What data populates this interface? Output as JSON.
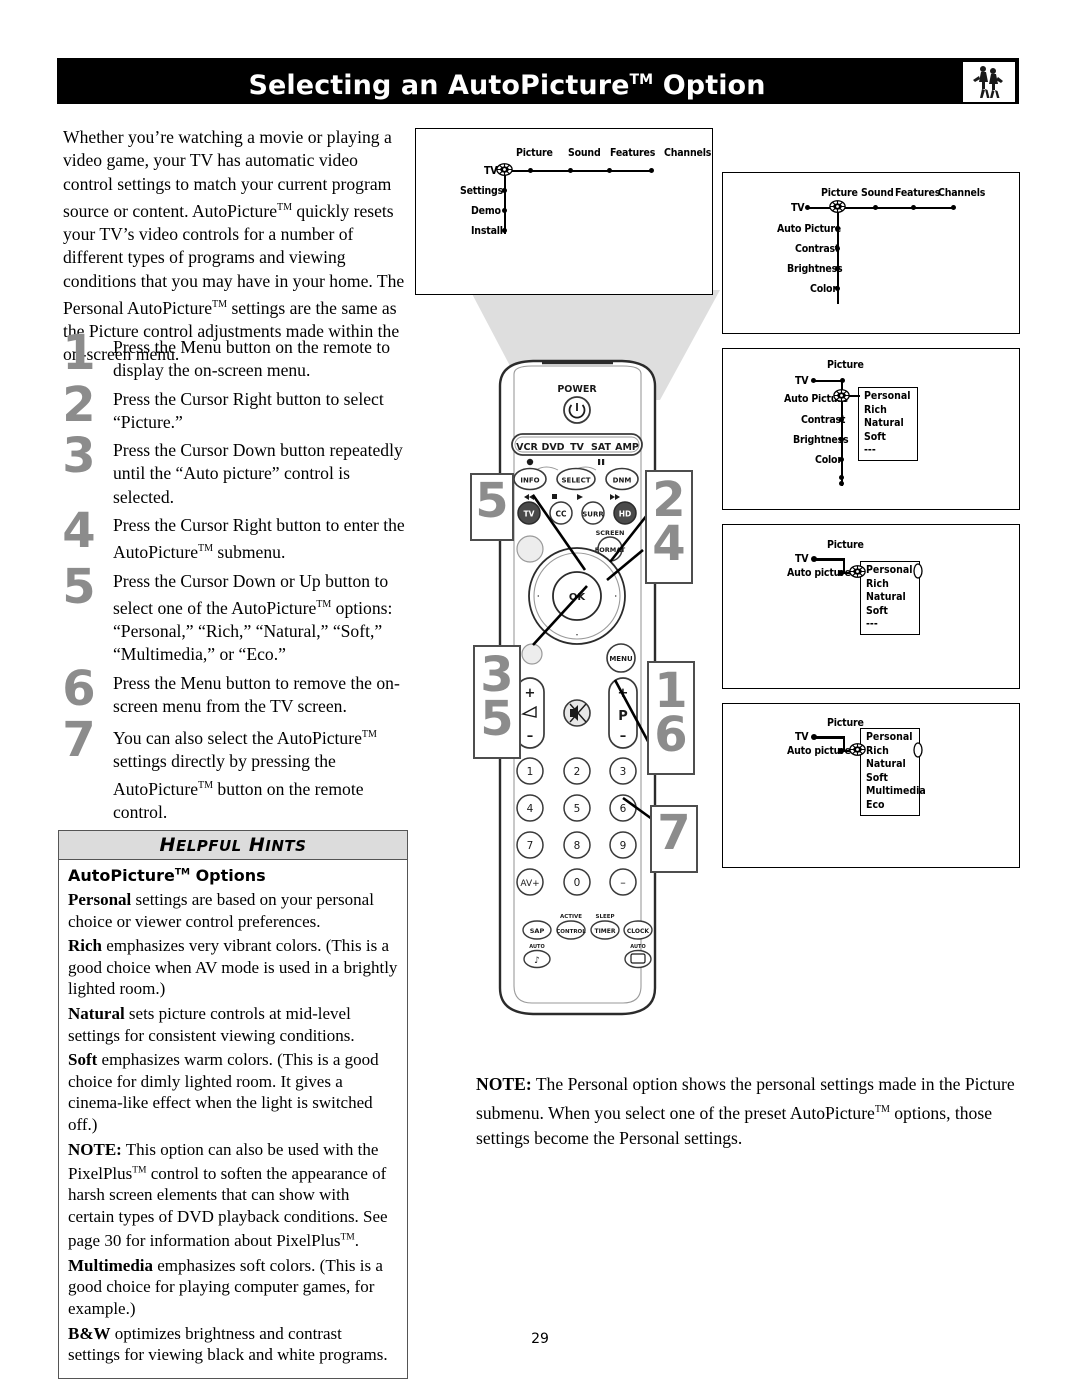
{
  "header": {
    "title_main": "Selecting an AutoPicture",
    "title_tm": "TM",
    "title_tail": " Option",
    "icon": "basketball-players-photo"
  },
  "intro": {
    "text": "Whether you’re watching a movie or playing a video game, your TV has automatic video control settings to match your current program source or content. AutoPicture™ quickly resets your TV’s video controls for a number of different types of programs and viewing conditions that you may have in your home.  The Personal AutoPicture™ settings are the same as the Picture control adjustments made within the on-screen menu."
  },
  "steps": [
    {
      "num": "1",
      "text": "Press the Menu button on the remote to display the on-screen menu."
    },
    {
      "num": "2",
      "text": "Press the Cursor Right button to select “Picture.”"
    },
    {
      "num": "3",
      "text": "Press the Cursor Down button repeatedly until the “Auto picture” control is selected."
    },
    {
      "num": "4",
      "text": "Press the Cursor Right button to enter the AutoPicture™ submenu."
    },
    {
      "num": "5",
      "text": "Press the Cursor Down or Up button to select one of the AutoPicture™ options: “Personal,” “Rich,” “Natural,” “Soft,” “Multimedia,” or “Eco.”"
    },
    {
      "num": "6",
      "text": "Press the Menu button to remove the on-screen menu from the TV screen."
    },
    {
      "num": "7",
      "text": "You can also select the AutoPicture™ settings directly by pressing the AutoPicture™ button on the remote control."
    }
  ],
  "hints": {
    "heading": "HELPFUL HINTS",
    "subtitle": "AutoPicture™ Options",
    "paragraphs": [
      {
        "lead": "Personal",
        "text": " settings are based on your personal choice or viewer control preferences."
      },
      {
        "lead": "Rich",
        "text": " emphasizes very vibrant colors. (This is a good choice when AV mode is used in a brightly lighted room.)"
      },
      {
        "lead": "Natural",
        "text": " sets picture controls at mid-level settings for consistent viewing conditions."
      },
      {
        "lead": "Soft",
        "text": " emphasizes warm colors. (This is a good choice for dimly lighted room. It gives a cinema-like effect when the light is switched off.)"
      },
      {
        "lead": "NOTE:",
        "text": " This option can also be used with the PixelPlus™ control to soften the appearance of harsh screen elements that can show with certain types of DVD playback conditions. See page 30 for information about PixelPlus™."
      },
      {
        "lead": "Multimedia",
        "text": " emphasizes soft colors. (This is a good choice for playing computer games, for example.)"
      },
      {
        "lead": "B&W",
        "text": " optimizes  brightness and contrast settings for viewing black and white programs."
      }
    ]
  },
  "screens": {
    "main_menu": {
      "row_labels": [
        "Picture",
        "Sound",
        "Features",
        "Channels"
      ],
      "root_label": "TV",
      "col_labels": [
        "Settings",
        "Demo",
        "Install"
      ],
      "cursor_at": "TV"
    },
    "picture_menu": {
      "row_labels": [
        "Picture",
        "Sound",
        "Features",
        "Channels"
      ],
      "root_label": "TV",
      "col_labels": [
        "Auto  Picture",
        "Contrast",
        "Brightness",
        "Color"
      ],
      "cursor_at": "Picture"
    },
    "autopicture_open": {
      "header_label": "Picture",
      "root_label": "TV",
      "col_labels": [
        "Auto  Picture",
        "Contrast",
        "Brightness",
        "Color"
      ],
      "submenu_items": [
        "Personal",
        "Rich",
        "Natural",
        "Soft",
        "---"
      ],
      "cursor_at": "Auto Picture"
    },
    "submenu_entered": {
      "header_label": "Picture",
      "root_label": "TV",
      "row_label": "Auto  picture",
      "submenu_items": [
        "Personal",
        "Rich",
        "Natural",
        "Soft",
        "---"
      ],
      "cursor_at": "Personal"
    },
    "submenu_select": {
      "header_label": "Picture",
      "root_label": "TV",
      "row_label": "Auto  picture",
      "submenu_items": [
        "Personal",
        "Rich",
        "Natural",
        "Soft",
        "Multimedia",
        "Eco"
      ],
      "cursor_at": "Rich"
    }
  },
  "remote": {
    "power_label": "POWER",
    "mode_buttons": [
      "VCR",
      "DVD",
      "TV",
      "SAT",
      "AMP"
    ],
    "row_info": [
      "INFO",
      "SELECT",
      "DNM"
    ],
    "row_source": [
      "TV",
      "CC",
      "SURR",
      "HD"
    ],
    "screen_format_top": "SCREEN",
    "screen_format": "FORMAT",
    "ok_label": "OK",
    "menu_label": "MENU",
    "volume_plus": "+",
    "volume_minus": "–",
    "program_plus": "+",
    "program_label": "P",
    "program_minus": "–",
    "numbers": [
      "1",
      "2",
      "3",
      "4",
      "5",
      "6",
      "7",
      "8",
      "9",
      "AV+",
      "0",
      "–"
    ],
    "bottom_row": [
      {
        "top": "",
        "label": "SAP"
      },
      {
        "top": "ACTIVE",
        "label": "CONTROL"
      },
      {
        "top": "SLEEP",
        "label": "TIMER"
      },
      {
        "top": "",
        "label": "CLOCK"
      }
    ],
    "auto_sound_top": "AUTO",
    "auto_picture_top": "AUTO"
  },
  "callouts": [
    {
      "name": "callout-5-left",
      "values": [
        "5"
      ]
    },
    {
      "name": "callout-2-4",
      "values": [
        "2",
        "4"
      ]
    },
    {
      "name": "callout-3-5",
      "values": [
        "3",
        "5"
      ]
    },
    {
      "name": "callout-1-6",
      "values": [
        "1",
        "6"
      ]
    },
    {
      "name": "callout-7",
      "values": [
        "7"
      ]
    }
  ],
  "note": {
    "lead": "NOTE:",
    "text": " The Personal option shows the personal settings made in the Picture submenu. When you select one of the preset AutoPicture™ options, those settings become the Personal settings."
  },
  "page_number": "29",
  "colors": {
    "header_bg": "#000000",
    "callout_number": "#8c8c8c",
    "hints_header_bg": "#dcdcdc",
    "beam": "#d9d9d9"
  }
}
